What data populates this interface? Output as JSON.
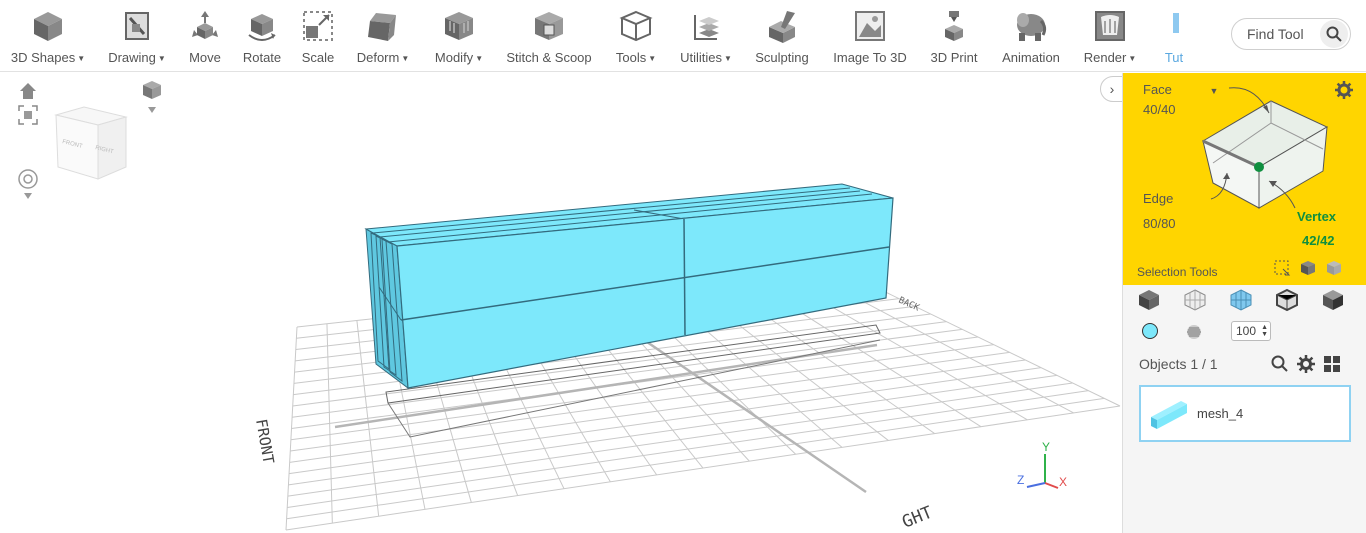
{
  "toolbar": {
    "items": [
      {
        "label": "3D Shapes",
        "dropdown": true,
        "icon": "cube-icon"
      },
      {
        "label": "Drawing",
        "dropdown": true,
        "icon": "drawing-icon"
      },
      {
        "label": "Move",
        "dropdown": false,
        "icon": "move-icon"
      },
      {
        "label": "Rotate",
        "dropdown": false,
        "icon": "rotate-icon"
      },
      {
        "label": "Scale",
        "dropdown": false,
        "icon": "scale-icon"
      },
      {
        "label": "Deform",
        "dropdown": true,
        "icon": "deform-icon"
      },
      {
        "label": "Modify",
        "dropdown": true,
        "icon": "modify-icon"
      },
      {
        "label": "Stitch & Scoop",
        "dropdown": false,
        "icon": "stitch-scoop-icon"
      },
      {
        "label": "Tools",
        "dropdown": true,
        "icon": "tools-icon"
      },
      {
        "label": "Utilities",
        "dropdown": true,
        "icon": "utilities-icon"
      },
      {
        "label": "Sculpting",
        "dropdown": false,
        "icon": "sculpting-icon"
      },
      {
        "label": "Image To 3D",
        "dropdown": false,
        "icon": "image-to-3d-icon"
      },
      {
        "label": "3D Print",
        "dropdown": false,
        "icon": "3d-print-icon"
      },
      {
        "label": "Animation",
        "dropdown": false,
        "icon": "animation-icon"
      },
      {
        "label": "Render",
        "dropdown": true,
        "icon": "render-icon"
      },
      {
        "label": "Tut",
        "dropdown": false,
        "icon": "tutorial-icon"
      }
    ],
    "find_tool": "Find Tool"
  },
  "viewport": {
    "cube_labels": {
      "front": "FRONT",
      "right": "RIGHT"
    },
    "floor_labels": {
      "front": "FRONT",
      "right": "GHT",
      "back": "BACK"
    },
    "axes": {
      "x": "X",
      "y": "Y",
      "z": "Z"
    }
  },
  "selection": {
    "face_label": "Face",
    "face_count": "40/40",
    "edge_label": "Edge",
    "edge_count": "80/80",
    "vertex_label": "Vertex",
    "vertex_count": "42/42",
    "tools_label": "Selection Tools"
  },
  "panel": {
    "opacity_value": "100",
    "objects_title": "Objects 1 / 1",
    "object_name": "mesh_4"
  },
  "colors": {
    "accent": "#ffd500",
    "mesh": "#7de8fb",
    "mesh_dark": "#5cc6df",
    "vertex": "#0f8f3f"
  }
}
